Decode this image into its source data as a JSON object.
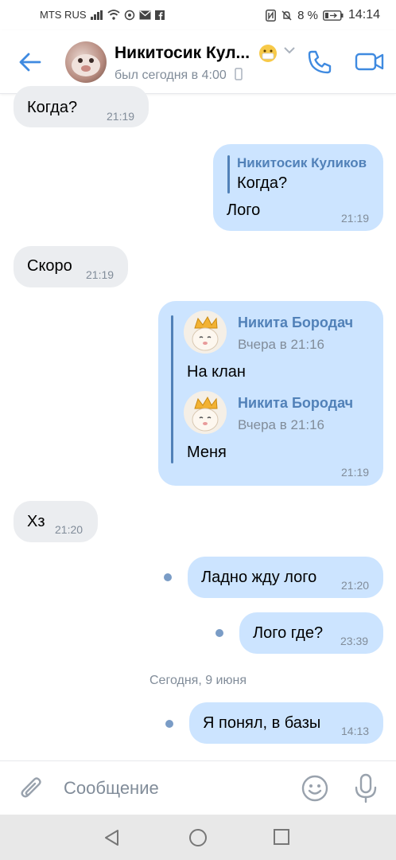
{
  "status_bar": {
    "carrier": "MTS RUS",
    "battery": "8 %",
    "time": "14:14"
  },
  "header": {
    "title": "Никитосик Кул...",
    "subtitle": "был сегодня в 4:00",
    "back_icon": "arrow-left-icon",
    "call_icon": "phone-icon",
    "video_icon": "video-camera-icon",
    "accent_color": "#3f8ae0"
  },
  "messages": [
    {
      "dir": "in",
      "text": "Когда?",
      "time": "21:19"
    },
    {
      "dir": "out",
      "reply": {
        "name": "Никитосик Куликов",
        "text": "Когда?"
      },
      "text": "Лого",
      "time": "21:19"
    },
    {
      "dir": "in",
      "text": "Скоро",
      "time": "21:19"
    },
    {
      "dir": "out",
      "forwarded": [
        {
          "name": "Никита Бородач",
          "date": "Вчера в 21:16",
          "text": "На клан"
        },
        {
          "name": "Никита Бородач",
          "date": "Вчера в 21:16",
          "text": "Меня"
        }
      ],
      "time": "21:19"
    },
    {
      "dir": "in",
      "text": "Хз",
      "time": "21:20"
    },
    {
      "dir": "out",
      "text": "Ладно жду лого",
      "time": "21:20",
      "unread": true
    },
    {
      "dir": "out",
      "text": "Лого где?",
      "time": "23:39",
      "unread": true
    },
    {
      "dir": "out",
      "text": "Я понял, в базы",
      "time": "14:13",
      "unread": true
    }
  ],
  "date_separator": "Сегодня, 9 июня",
  "composer": {
    "placeholder": "Сообщение",
    "attach_icon": "paperclip-icon",
    "emoji_icon": "smiley-icon",
    "mic_icon": "microphone-icon"
  },
  "colors": {
    "incoming_bubble": "#ebedf0",
    "outgoing_bubble": "#cce4ff",
    "link_blue": "#5181b8",
    "meta_gray": "#818c99"
  }
}
